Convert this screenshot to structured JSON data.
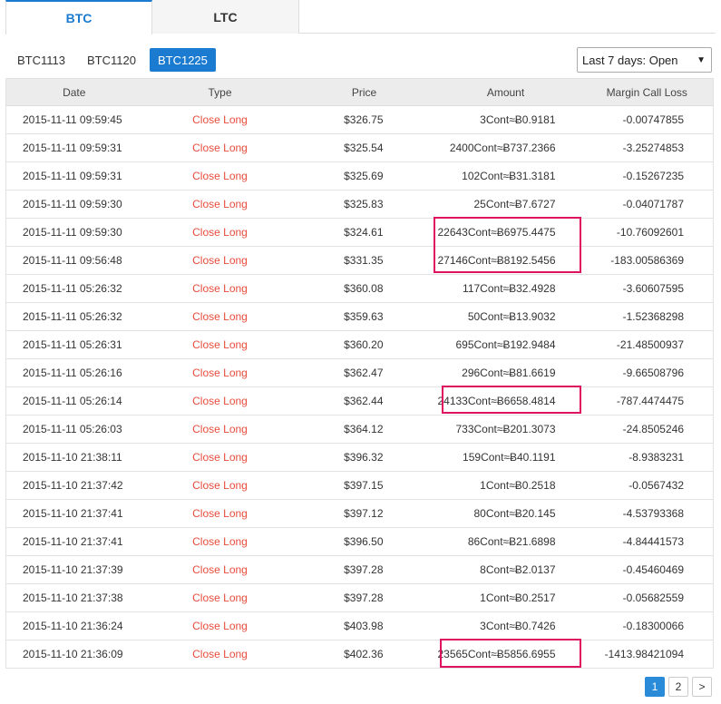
{
  "tabs": [
    {
      "label": "BTC",
      "active": true
    },
    {
      "label": "LTC",
      "active": false
    }
  ],
  "contracts": [
    {
      "label": "BTC1113",
      "active": false
    },
    {
      "label": "BTC1120",
      "active": false
    },
    {
      "label": "BTC1225",
      "active": true
    }
  ],
  "filter": {
    "selected": "Last 7 days: Open"
  },
  "table": {
    "headers": [
      "Date",
      "Type",
      "Price",
      "Amount",
      "Margin Call Loss"
    ],
    "rows": [
      {
        "date": "2015-11-11 09:59:45",
        "type": "Close Long",
        "price": "$326.75",
        "amount": "3Cont≈Ƀ0.9181",
        "loss": "-0.00747855"
      },
      {
        "date": "2015-11-11 09:59:31",
        "type": "Close Long",
        "price": "$325.54",
        "amount": "2400Cont≈Ƀ737.2366",
        "loss": "-3.25274853"
      },
      {
        "date": "2015-11-11 09:59:31",
        "type": "Close Long",
        "price": "$325.69",
        "amount": "102Cont≈Ƀ31.3181",
        "loss": "-0.15267235"
      },
      {
        "date": "2015-11-11 09:59:30",
        "type": "Close Long",
        "price": "$325.83",
        "amount": "25Cont≈Ƀ7.6727",
        "loss": "-0.04071787"
      },
      {
        "date": "2015-11-11 09:59:30",
        "type": "Close Long",
        "price": "$324.61",
        "amount": "22643Cont≈Ƀ6975.4475",
        "loss": "-10.76092601"
      },
      {
        "date": "2015-11-11 09:56:48",
        "type": "Close Long",
        "price": "$331.35",
        "amount": "27146Cont≈Ƀ8192.5456",
        "loss": "-183.00586369"
      },
      {
        "date": "2015-11-11 05:26:32",
        "type": "Close Long",
        "price": "$360.08",
        "amount": "117Cont≈Ƀ32.4928",
        "loss": "-3.60607595"
      },
      {
        "date": "2015-11-11 05:26:32",
        "type": "Close Long",
        "price": "$359.63",
        "amount": "50Cont≈Ƀ13.9032",
        "loss": "-1.52368298"
      },
      {
        "date": "2015-11-11 05:26:31",
        "type": "Close Long",
        "price": "$360.20",
        "amount": "695Cont≈Ƀ192.9484",
        "loss": "-21.48500937"
      },
      {
        "date": "2015-11-11 05:26:16",
        "type": "Close Long",
        "price": "$362.47",
        "amount": "296Cont≈Ƀ81.6619",
        "loss": "-9.66508796"
      },
      {
        "date": "2015-11-11 05:26:14",
        "type": "Close Long",
        "price": "$362.44",
        "amount": "24133Cont≈Ƀ6658.4814",
        "loss": "-787.4474475"
      },
      {
        "date": "2015-11-11 05:26:03",
        "type": "Close Long",
        "price": "$364.12",
        "amount": "733Cont≈Ƀ201.3073",
        "loss": "-24.8505246"
      },
      {
        "date": "2015-11-10 21:38:11",
        "type": "Close Long",
        "price": "$396.32",
        "amount": "159Cont≈Ƀ40.1191",
        "loss": "-8.9383231"
      },
      {
        "date": "2015-11-10 21:37:42",
        "type": "Close Long",
        "price": "$397.15",
        "amount": "1Cont≈Ƀ0.2518",
        "loss": "-0.0567432"
      },
      {
        "date": "2015-11-10 21:37:41",
        "type": "Close Long",
        "price": "$397.12",
        "amount": "80Cont≈Ƀ20.145",
        "loss": "-4.53793368"
      },
      {
        "date": "2015-11-10 21:37:41",
        "type": "Close Long",
        "price": "$396.50",
        "amount": "86Cont≈Ƀ21.6898",
        "loss": "-4.84441573"
      },
      {
        "date": "2015-11-10 21:37:39",
        "type": "Close Long",
        "price": "$397.28",
        "amount": "8Cont≈Ƀ2.0137",
        "loss": "-0.45460469"
      },
      {
        "date": "2015-11-10 21:37:38",
        "type": "Close Long",
        "price": "$397.28",
        "amount": "1Cont≈Ƀ0.2517",
        "loss": "-0.05682559"
      },
      {
        "date": "2015-11-10 21:36:24",
        "type": "Close Long",
        "price": "$403.98",
        "amount": "3Cont≈Ƀ0.7426",
        "loss": "-0.18300066"
      },
      {
        "date": "2015-11-10 21:36:09",
        "type": "Close Long",
        "price": "$402.36",
        "amount": "23565Cont≈Ƀ5856.6955",
        "loss": "-1413.98421094"
      }
    ]
  },
  "pagination": {
    "pages": [
      "1",
      "2"
    ],
    "active": "1",
    "next": ">"
  },
  "colors": {
    "accent": "#1a7bd0",
    "close_long": "#e74c3c",
    "highlight": "#e0115f"
  }
}
